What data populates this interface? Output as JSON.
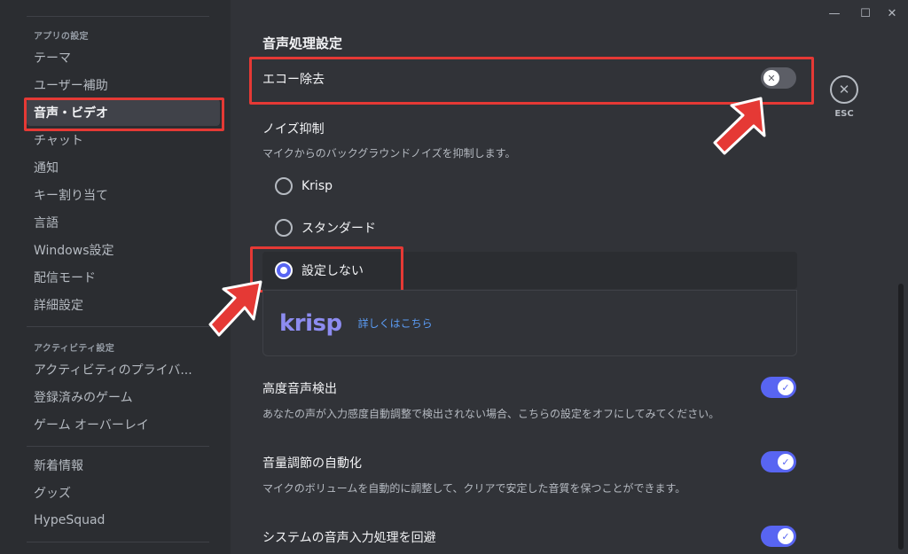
{
  "window_controls": {
    "minimize": "—",
    "maximize": "☐",
    "close": "✕"
  },
  "sidebar": {
    "sections": [
      {
        "label": "アプリの設定"
      },
      {
        "label": "アクティビティ設定"
      }
    ],
    "items": [
      {
        "label": "テーマ"
      },
      {
        "label": "ユーザー補助"
      },
      {
        "label": "音声・ビデオ",
        "selected": true
      },
      {
        "label": "チャット"
      },
      {
        "label": "通知"
      },
      {
        "label": "キー割り当て"
      },
      {
        "label": "言語"
      },
      {
        "label": "Windows設定"
      },
      {
        "label": "配信モード"
      },
      {
        "label": "詳細設定"
      },
      {
        "label": "アクティビティのプライバ..."
      },
      {
        "label": "登録済みのゲーム"
      },
      {
        "label": "ゲーム オーバーレイ"
      },
      {
        "label": "新着情報"
      },
      {
        "label": "グッズ"
      },
      {
        "label": "HypeSquad"
      }
    ]
  },
  "main": {
    "section_title": "音声処理設定",
    "echo": {
      "label": "エコー除去",
      "enabled": false
    },
    "noise": {
      "title": "ノイズ抑制",
      "description": "マイクからのバックグラウンドノイズを抑制します。",
      "options": [
        {
          "label": "Krisp",
          "selected": false
        },
        {
          "label": "スタンダード",
          "selected": false
        },
        {
          "label": "設定しない",
          "selected": true
        }
      ],
      "krisp_logo": "krisp",
      "krisp_link": "詳しくはこちら"
    },
    "vad": {
      "label": "高度音声検出",
      "description": "あなたの声が入力感度自動調整で検出されない場合、こちらの設定をオフにしてみてください。",
      "enabled": true
    },
    "agc": {
      "label": "音量調節の自動化",
      "description": "マイクのボリュームを自動的に調整して、クリアで安定した音質を保つことができます。",
      "enabled": true
    },
    "bypass": {
      "label": "システムの音声入力処理を回避",
      "enabled": true
    }
  },
  "close": {
    "icon": "✕",
    "label": "ESC"
  },
  "colors": {
    "accent": "#5865f2",
    "highlight": "#e53935",
    "background": "#313338",
    "sidebar": "#2b2d31"
  }
}
